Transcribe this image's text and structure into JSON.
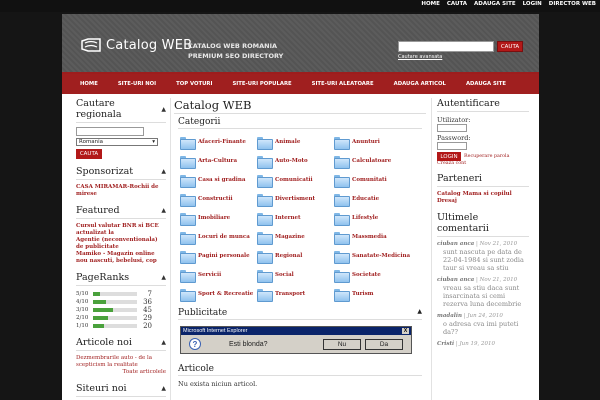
{
  "top_links": [
    "HOME",
    "CAUTA",
    "ADAUGA SITE",
    "LOGIN",
    "DIRECTOR WEB"
  ],
  "header": {
    "logo_text": "Catalog WEB",
    "tagline_1": "CATALOG WEB ROMANIA",
    "tagline_2": "PREMIUM SEO DIRECTORY",
    "search_button": "CAUTA",
    "advanced_link": "Cautare avansata"
  },
  "nav": [
    "HOME",
    "SITE-URI NOI",
    "TOP VOTURI",
    "SITE-URI POPULARE",
    "SITE-URI ALEATOARE",
    "ADAUGA ARTICOL",
    "ADAUGA SITE"
  ],
  "left": {
    "regional_title": "Cautare regionala",
    "region_selected": "Romania",
    "region_button": "CAUTA",
    "sponsored_title": "Sponsorizat",
    "sponsored_link": "CASA MIRAMAR-Rochii de mirese",
    "featured_title": "Featured",
    "featured_links": [
      "Cursul valutar BNR si BCE actualizat la",
      "Agentie (neconventionala) de publicitate",
      "Mamiko - Magazin online nou nascuti, bebelusi, cop"
    ],
    "pagerank_title": "PageRanks",
    "pageranks": [
      {
        "label": "5/10",
        "count": "7",
        "fill": 0.15
      },
      {
        "label": "4/10",
        "count": "36",
        "fill": 0.3
      },
      {
        "label": "3/10",
        "count": "45",
        "fill": 0.45
      },
      {
        "label": "2/10",
        "count": "29",
        "fill": 0.35
      },
      {
        "label": "1/10",
        "count": "20",
        "fill": 0.25
      }
    ],
    "articles_title": "Articole noi",
    "article_link": "Dezmembrarile auto - de la scepticism la realitate",
    "all_articles": "Toate articolele",
    "new_sites_title": "Siteuri noi"
  },
  "main": {
    "title": "Catalog WEB",
    "categories_title": "Categorii",
    "categories": [
      "Afaceri-Finante",
      "Animale",
      "Anunturi",
      "Arta-Cultura",
      "Auto-Moto",
      "Calculatoare",
      "Casa si gradina",
      "Comunicatii",
      "Comunitati",
      "Constructii",
      "Divertisment",
      "Educatie",
      "Imobiliare",
      "Internet",
      "Lifestyle",
      "Locuri de munca",
      "Magazine",
      "Massmedia",
      "Pagini personale",
      "Regional",
      "Sanatate-Medicina",
      "Servicii",
      "Social",
      "Societate",
      "Sport & Recreatie",
      "Transport",
      "Turism"
    ],
    "ad_title": "Publicitate",
    "dialog": {
      "title": "Microsoft Internet Explorer",
      "close": "X",
      "question": "Esti blonda?",
      "no": "Nu",
      "yes": "Da"
    },
    "articles_title": "Articole",
    "articles_empty": "Nu exista niciun articol."
  },
  "right": {
    "auth_title": "Autentificare",
    "user_label": "Utilizator:",
    "password_label": "Password:",
    "login_button": "LOGIN",
    "recover_link": "Recuperare parola",
    "create_link": "Creaza cont",
    "partners_title": "Parteneri",
    "partner_link": "Catalog Mama si copilul Dresaj",
    "comments_title": "Ultimele comentarii",
    "comments": [
      {
        "author": "ciuban anca",
        "date": "Nov 21, 2010",
        "text": "sunt nascuta pe data de 22-04-1984 si sunt zodia taur si vreau sa stiu"
      },
      {
        "author": "ciuban anca",
        "date": "Nov 21, 2010",
        "text": "vreau sa stiu daca sunt insarcinata si cemi rezerva luna decembrie"
      },
      {
        "author": "madalin",
        "date": "Jun 24, 2010",
        "text": "o adresa cva imi puteti da??"
      },
      {
        "author": "Cristi",
        "date": "Jun 19, 2010",
        "text": ""
      }
    ]
  }
}
